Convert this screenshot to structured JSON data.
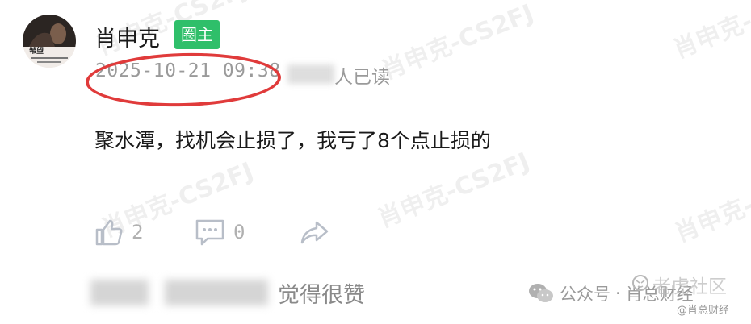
{
  "watermark_text": "肖申克-CS2FJ",
  "post": {
    "author": "肖申克",
    "badge": "圈主",
    "timestamp": "2025-10-21 09:38",
    "read_suffix": "人已读",
    "content": "聚水潭，找机会止损了，我亏了8个点止损的",
    "likes": "2",
    "comments": "0",
    "avatar_caption": "希望"
  },
  "footer": {
    "liked_text": "觉得很赞",
    "wechat_label": "公众号",
    "wechat_separator": "·",
    "wechat_account": "肖总财经",
    "brand_watermark": "老虎社区",
    "brand_sub": "@肖总财经"
  },
  "colors": {
    "badge": "#2fbf6a",
    "highlight_ellipse": "#e03b3b",
    "muted_text": "#9a9a9a"
  },
  "icons": [
    "thumbs-up-icon",
    "comment-icon",
    "share-icon",
    "wechat-icon",
    "tiger-icon"
  ]
}
